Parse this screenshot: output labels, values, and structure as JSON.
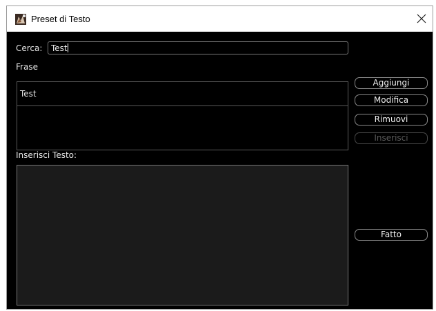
{
  "window": {
    "title": "Preset di Testo"
  },
  "search": {
    "label": "Cerca:",
    "value": "Test"
  },
  "phrases": {
    "header": "Frase",
    "items": [
      "Test"
    ]
  },
  "insert": {
    "label": "Inserisci Testo:",
    "value": ""
  },
  "buttons": {
    "add": "Aggiungi",
    "edit": "Modifica",
    "remove": "Rimuovi",
    "insert": "Inserisci",
    "done": "Fatto"
  },
  "icons": {
    "app": "app-logo-icon",
    "close": "close-icon"
  }
}
